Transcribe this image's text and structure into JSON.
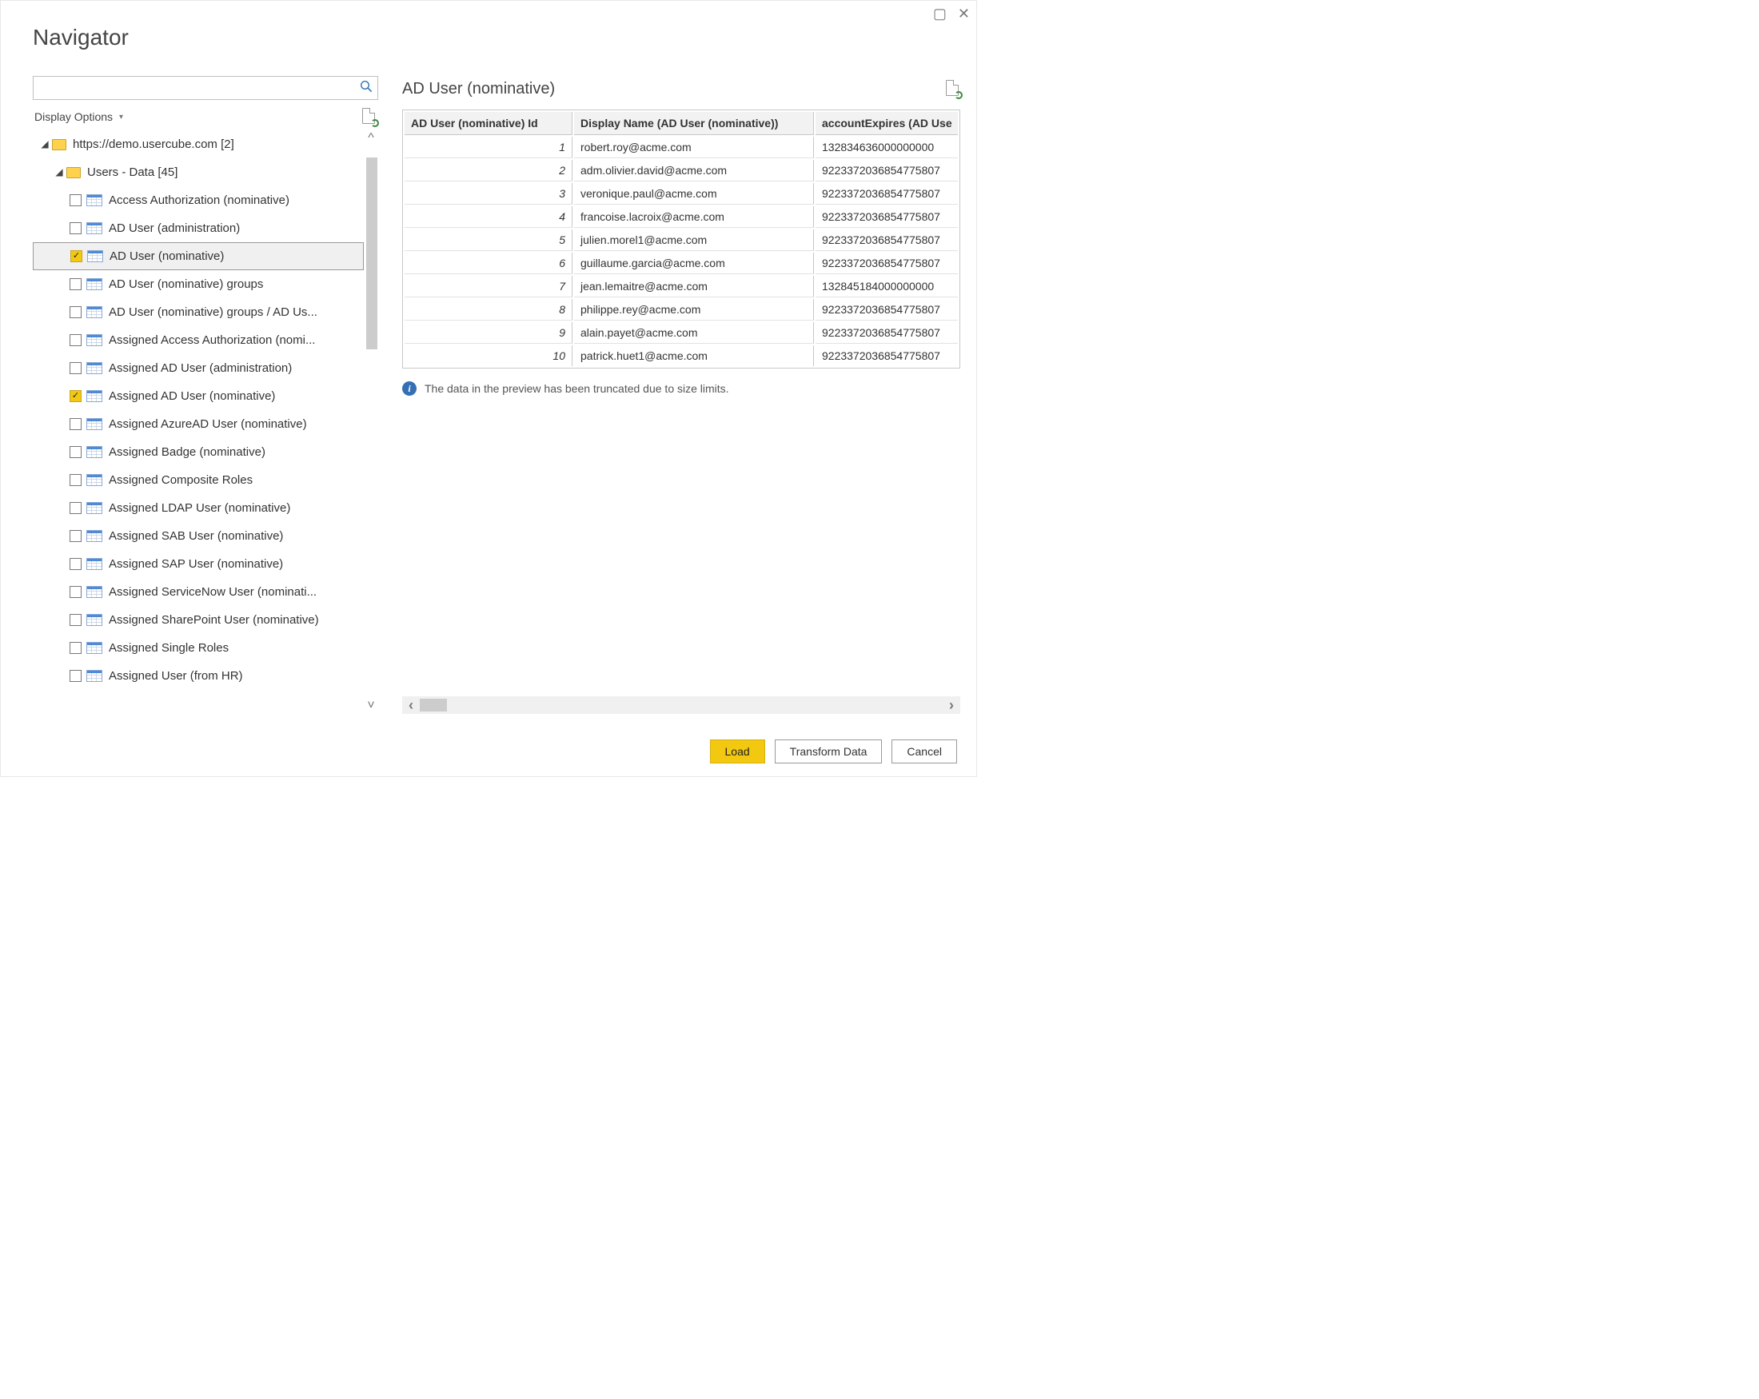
{
  "window": {
    "title": "Navigator"
  },
  "left": {
    "search_placeholder": "",
    "display_options_label": "Display Options",
    "tree": {
      "root": {
        "label": "https://demo.usercube.com [2]"
      },
      "group": {
        "label": "Users - Data [45]"
      },
      "items": [
        {
          "label": "Access Authorization (nominative)",
          "checked": false,
          "selected": false
        },
        {
          "label": "AD User (administration)",
          "checked": false,
          "selected": false
        },
        {
          "label": "AD User (nominative)",
          "checked": true,
          "selected": true
        },
        {
          "label": "AD User (nominative) groups",
          "checked": false,
          "selected": false
        },
        {
          "label": "AD User (nominative) groups / AD Us...",
          "checked": false,
          "selected": false
        },
        {
          "label": "Assigned Access Authorization (nomi...",
          "checked": false,
          "selected": false
        },
        {
          "label": "Assigned AD User (administration)",
          "checked": false,
          "selected": false
        },
        {
          "label": "Assigned AD User (nominative)",
          "checked": true,
          "selected": false
        },
        {
          "label": "Assigned AzureAD User (nominative)",
          "checked": false,
          "selected": false
        },
        {
          "label": "Assigned Badge (nominative)",
          "checked": false,
          "selected": false
        },
        {
          "label": "Assigned Composite Roles",
          "checked": false,
          "selected": false
        },
        {
          "label": "Assigned LDAP User (nominative)",
          "checked": false,
          "selected": false
        },
        {
          "label": "Assigned SAB User (nominative)",
          "checked": false,
          "selected": false
        },
        {
          "label": "Assigned SAP User (nominative)",
          "checked": false,
          "selected": false
        },
        {
          "label": "Assigned ServiceNow User (nominati...",
          "checked": false,
          "selected": false
        },
        {
          "label": "Assigned SharePoint User (nominative)",
          "checked": false,
          "selected": false
        },
        {
          "label": "Assigned Single Roles",
          "checked": false,
          "selected": false
        },
        {
          "label": "Assigned User (from HR)",
          "checked": false,
          "selected": false
        }
      ]
    }
  },
  "right": {
    "title": "AD User (nominative)",
    "columns": [
      "AD User (nominative) Id",
      "Display Name (AD User (nominative))",
      "accountExpires (AD Use"
    ],
    "rows": [
      {
        "id": "1",
        "name": "robert.roy@acme.com",
        "expires": "132834636000000000"
      },
      {
        "id": "2",
        "name": "adm.olivier.david@acme.com",
        "expires": "9223372036854775807"
      },
      {
        "id": "3",
        "name": "veronique.paul@acme.com",
        "expires": "9223372036854775807"
      },
      {
        "id": "4",
        "name": "francoise.lacroix@acme.com",
        "expires": "9223372036854775807"
      },
      {
        "id": "5",
        "name": "julien.morel1@acme.com",
        "expires": "9223372036854775807"
      },
      {
        "id": "6",
        "name": "guillaume.garcia@acme.com",
        "expires": "9223372036854775807"
      },
      {
        "id": "7",
        "name": "jean.lemaitre@acme.com",
        "expires": "132845184000000000"
      },
      {
        "id": "8",
        "name": "philippe.rey@acme.com",
        "expires": "9223372036854775807"
      },
      {
        "id": "9",
        "name": "alain.payet@acme.com",
        "expires": "9223372036854775807"
      },
      {
        "id": "10",
        "name": "patrick.huet1@acme.com",
        "expires": "9223372036854775807"
      }
    ],
    "info_text": "The data in the preview has been truncated due to size limits."
  },
  "footer": {
    "load": "Load",
    "transform": "Transform Data",
    "cancel": "Cancel"
  }
}
